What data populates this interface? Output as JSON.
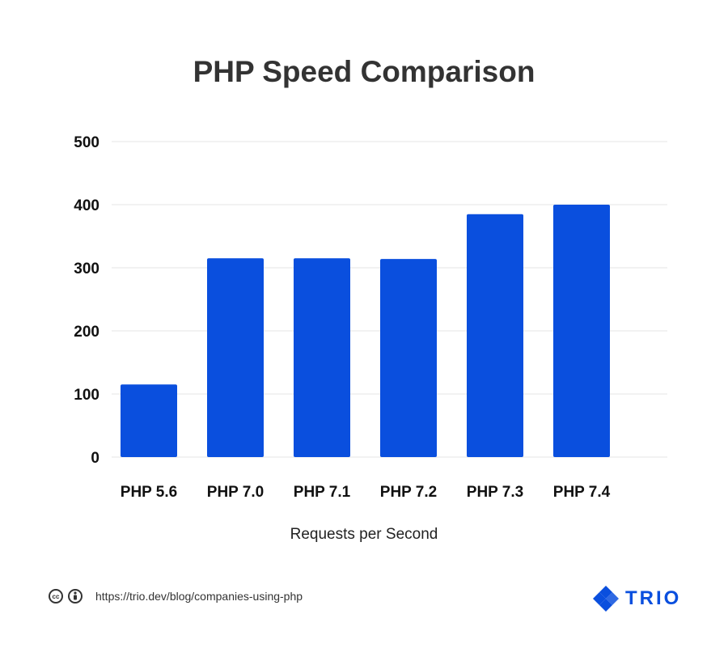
{
  "chart_data": {
    "type": "bar",
    "title": "PHP Speed Comparison",
    "categories": [
      "PHP 5.6",
      "PHP 7.0",
      "PHP 7.1",
      "PHP 7.2",
      "PHP 7.3",
      "PHP 7.4"
    ],
    "values": [
      115,
      315,
      315,
      314,
      385,
      400
    ],
    "xlabel": "Requests per Second",
    "ylabel": "",
    "ylim": [
      0,
      500
    ],
    "yticks": [
      0,
      100,
      200,
      300,
      400,
      500
    ],
    "grid": true,
    "bar_color": "#0a4fde"
  },
  "footer": {
    "url": "https://trio.dev/blog/companies-using-php",
    "license_icons": [
      "creative-commons-icon",
      "attribution-icon"
    ],
    "brand": "TRIO",
    "brand_color": "#0a4fde"
  }
}
